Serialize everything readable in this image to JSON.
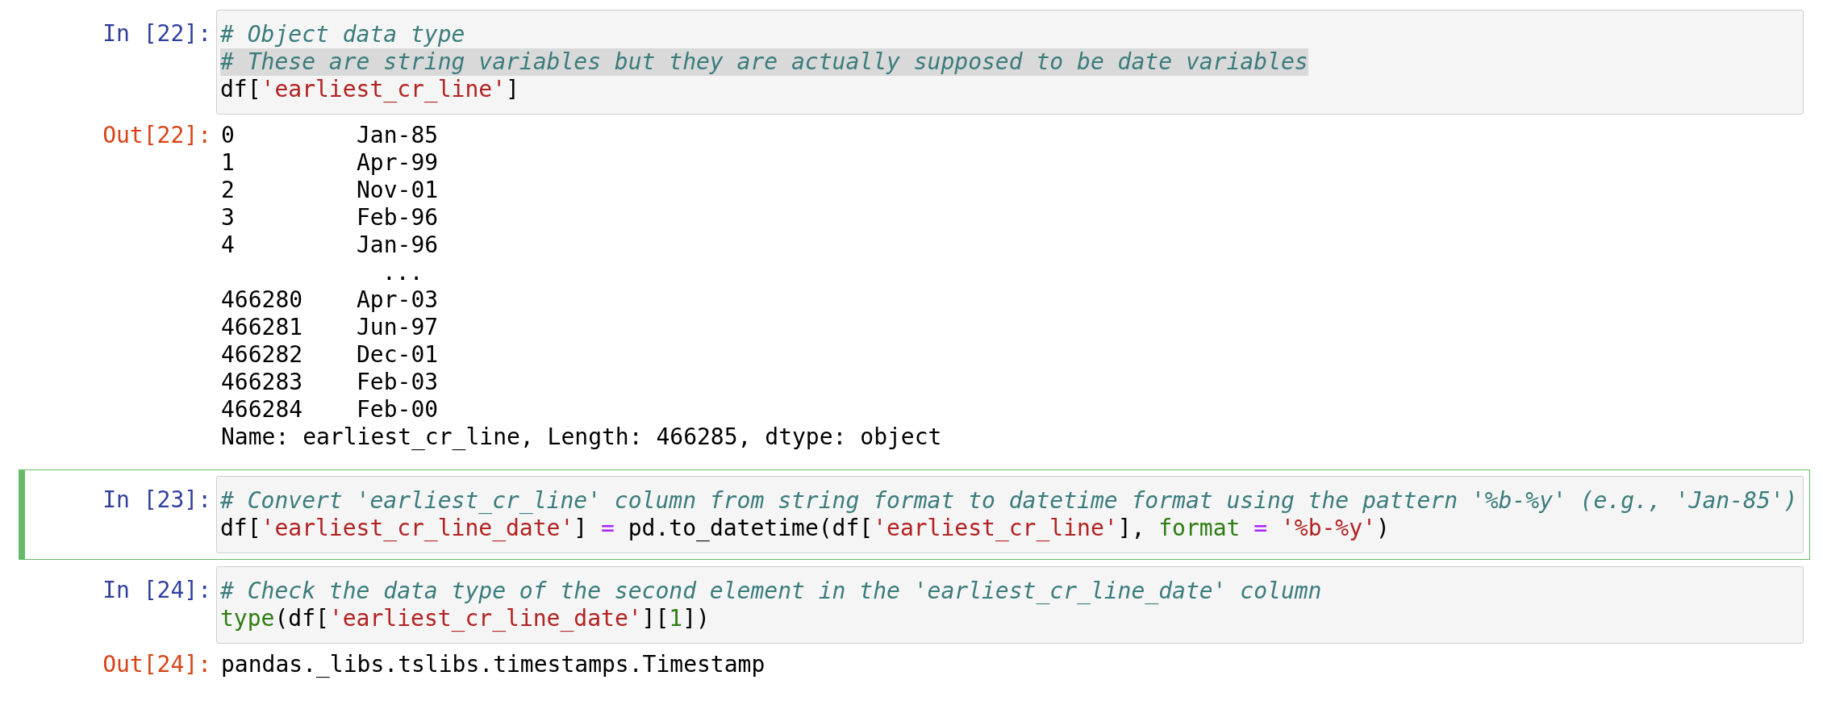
{
  "cells": [
    {
      "kind": "code",
      "prompt": "In [22]:",
      "selected": false,
      "lines": [
        {
          "highlighted": false,
          "tokens": [
            {
              "kind": "comment",
              "text": "# Object data type"
            }
          ]
        },
        {
          "highlighted": true,
          "tokens": [
            {
              "kind": "comment",
              "text": "# These are string variables but they are actually supposed to be date variables"
            }
          ]
        },
        {
          "highlighted": false,
          "tokens": [
            {
              "kind": "plain",
              "text": "df["
            },
            {
              "kind": "string",
              "text": "'earliest_cr_line'"
            },
            {
              "kind": "plain",
              "text": "]"
            }
          ]
        }
      ]
    },
    {
      "kind": "series",
      "prompt": "Out[22]:",
      "rows": [
        {
          "index": "0",
          "value": "Jan-85"
        },
        {
          "index": "1",
          "value": "Apr-99"
        },
        {
          "index": "2",
          "value": "Nov-01"
        },
        {
          "index": "3",
          "value": "Feb-96"
        },
        {
          "index": "4",
          "value": "Jan-96"
        }
      ],
      "ellipsis": "...",
      "tail_rows": [
        {
          "index": "466280",
          "value": "Apr-03"
        },
        {
          "index": "466281",
          "value": "Jun-97"
        },
        {
          "index": "466282",
          "value": "Dec-01"
        },
        {
          "index": "466283",
          "value": "Feb-03"
        },
        {
          "index": "466284",
          "value": "Feb-00"
        }
      ],
      "summary": "Name: earliest_cr_line, Length: 466285, dtype: object"
    },
    {
      "kind": "code",
      "prompt": "In [23]:",
      "selected": true,
      "lines": [
        {
          "highlighted": false,
          "tokens": [
            {
              "kind": "comment",
              "text": "# Convert 'earliest_cr_line' column from string format to datetime format using the pattern '%b-%y' (e.g., 'Jan-85')"
            }
          ]
        },
        {
          "highlighted": false,
          "tokens": [
            {
              "kind": "plain",
              "text": "df["
            },
            {
              "kind": "string",
              "text": "'earliest_cr_line_date'"
            },
            {
              "kind": "plain",
              "text": "] "
            },
            {
              "kind": "operator",
              "text": "="
            },
            {
              "kind": "plain",
              "text": " pd.to_datetime(df["
            },
            {
              "kind": "string",
              "text": "'earliest_cr_line'"
            },
            {
              "kind": "plain",
              "text": "], "
            },
            {
              "kind": "keyword",
              "text": "format"
            },
            {
              "kind": "operator",
              "text": " = "
            },
            {
              "kind": "string",
              "text": "'%b-%y'"
            },
            {
              "kind": "plain",
              "text": ")"
            }
          ]
        }
      ]
    },
    {
      "kind": "code",
      "prompt": "In [24]:",
      "selected": false,
      "lines": [
        {
          "highlighted": false,
          "tokens": [
            {
              "kind": "comment",
              "text": "# Check the data type of the second element in the 'earliest_cr_line_date' column"
            }
          ]
        },
        {
          "highlighted": false,
          "tokens": [
            {
              "kind": "builtin",
              "text": "type"
            },
            {
              "kind": "plain",
              "text": "(df["
            },
            {
              "kind": "string",
              "text": "'earliest_cr_line_date'"
            },
            {
              "kind": "plain",
              "text": "]["
            },
            {
              "kind": "number",
              "text": "1"
            },
            {
              "kind": "plain",
              "text": "])"
            }
          ]
        }
      ]
    },
    {
      "kind": "text",
      "prompt": "Out[24]:",
      "text": "pandas._libs.tslibs.timestamps.Timestamp"
    }
  ]
}
